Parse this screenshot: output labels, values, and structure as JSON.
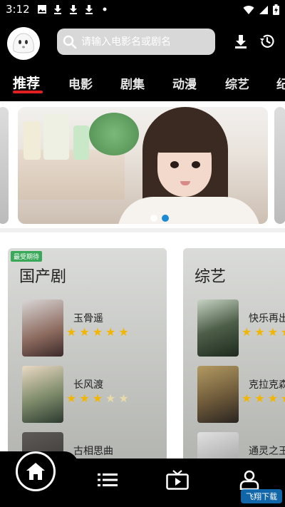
{
  "status_bar": {
    "time": "3:12",
    "left_icons": [
      "image-icon",
      "download-icon",
      "download-icon",
      "download-icon",
      "dot-icon"
    ],
    "right_icons": [
      "wifi-icon",
      "signal-icon",
      "battery-icon"
    ]
  },
  "header": {
    "search_placeholder": "请输入电影名或剧名",
    "icons": [
      "search-icon",
      "download-icon",
      "history-icon"
    ]
  },
  "tabs": [
    {
      "label": "推荐",
      "active": true
    },
    {
      "label": "电影",
      "active": false
    },
    {
      "label": "剧集",
      "active": false
    },
    {
      "label": "动漫",
      "active": false
    },
    {
      "label": "综艺",
      "active": false
    },
    {
      "label": "纪",
      "active": false
    }
  ],
  "banner": {
    "active_dot": 1,
    "dot_count": 2
  },
  "cards": [
    {
      "badge": "最受期待",
      "title": "国产剧",
      "items": [
        {
          "name": "玉骨遥",
          "rating": 5
        },
        {
          "name": "长风渡",
          "rating": 3.5
        },
        {
          "name": "古相思曲",
          "rating": 0
        }
      ]
    },
    {
      "title": "综艺",
      "items": [
        {
          "name": "快乐再出",
          "rating": 5
        },
        {
          "name": "克拉克森",
          "rating": 5
        },
        {
          "name": "通灵之王",
          "rating": 0
        }
      ]
    }
  ],
  "bottom_nav": {
    "items": [
      "home-icon",
      "list-icon",
      "tv-icon",
      "user-icon"
    ],
    "active": "home-icon"
  },
  "watermark": {
    "text": "飞翔下载"
  },
  "colors": {
    "accent": "#e02020",
    "star": "#f2b600",
    "dot_active": "#1b8ad6"
  }
}
